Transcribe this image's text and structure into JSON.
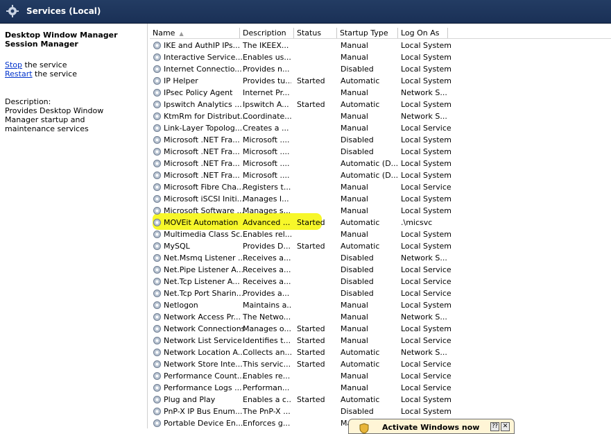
{
  "window": {
    "title": "Services (Local)"
  },
  "details": {
    "service_name": "Desktop Window Manager Session Manager",
    "stop_link": "Stop",
    "stop_suffix": " the service",
    "restart_link": "Restart",
    "restart_suffix": " the service",
    "description_label": "Description:",
    "description_text": "Provides Desktop Window Manager startup and maintenance services"
  },
  "columns": {
    "name": "Name",
    "description": "Description",
    "status": "Status",
    "startup_type": "Startup Type",
    "log_on_as": "Log On As"
  },
  "rows": [
    {
      "name": "IKE and AuthIP IPs...",
      "description": "The IKEEX...",
      "status": "",
      "startup": "Manual",
      "logon": "Local System"
    },
    {
      "name": "Interactive Service...",
      "description": "Enables us...",
      "status": "",
      "startup": "Manual",
      "logon": "Local System"
    },
    {
      "name": "Internet Connectio...",
      "description": "Provides n...",
      "status": "",
      "startup": "Disabled",
      "logon": "Local System"
    },
    {
      "name": "IP Helper",
      "description": "Provides tu...",
      "status": "Started",
      "startup": "Automatic",
      "logon": "Local System"
    },
    {
      "name": "IPsec Policy Agent",
      "description": "Internet Pr...",
      "status": "",
      "startup": "Manual",
      "logon": "Network S..."
    },
    {
      "name": "Ipswitch Analytics ...",
      "description": "Ipswitch A...",
      "status": "Started",
      "startup": "Automatic",
      "logon": "Local System"
    },
    {
      "name": "KtmRm for Distribut...",
      "description": "Coordinate...",
      "status": "",
      "startup": "Manual",
      "logon": "Network S..."
    },
    {
      "name": "Link-Layer Topolog...",
      "description": "Creates a ...",
      "status": "",
      "startup": "Manual",
      "logon": "Local Service"
    },
    {
      "name": "Microsoft .NET Fra...",
      "description": "Microsoft ....",
      "status": "",
      "startup": "Disabled",
      "logon": "Local System"
    },
    {
      "name": "Microsoft .NET Fra...",
      "description": "Microsoft ....",
      "status": "",
      "startup": "Disabled",
      "logon": "Local System"
    },
    {
      "name": "Microsoft .NET Fra...",
      "description": "Microsoft ....",
      "status": "",
      "startup": "Automatic (D...",
      "logon": "Local System"
    },
    {
      "name": "Microsoft .NET Fra...",
      "description": "Microsoft ....",
      "status": "",
      "startup": "Automatic (D...",
      "logon": "Local System"
    },
    {
      "name": "Microsoft Fibre Cha...",
      "description": "Registers t...",
      "status": "",
      "startup": "Manual",
      "logon": "Local Service"
    },
    {
      "name": "Microsoft iSCSI Initi...",
      "description": "Manages I...",
      "status": "",
      "startup": "Manual",
      "logon": "Local System"
    },
    {
      "name": "Microsoft Software ...",
      "description": "Manages s...",
      "status": "",
      "startup": "Manual",
      "logon": "Local System"
    },
    {
      "name": "MOVEit Automation",
      "description": "Advanced ...",
      "status": "Started",
      "startup": "Automatic",
      "logon": ".\\micsvc"
    },
    {
      "name": "Multimedia Class Sc...",
      "description": "Enables rel...",
      "status": "",
      "startup": "Manual",
      "logon": "Local System"
    },
    {
      "name": "MySQL",
      "description": "Provides D...",
      "status": "Started",
      "startup": "Automatic",
      "logon": "Local System"
    },
    {
      "name": "Net.Msmq Listener ...",
      "description": "Receives a...",
      "status": "",
      "startup": "Disabled",
      "logon": "Network S..."
    },
    {
      "name": "Net.Pipe Listener A...",
      "description": "Receives a...",
      "status": "",
      "startup": "Disabled",
      "logon": "Local Service"
    },
    {
      "name": "Net.Tcp Listener A...",
      "description": "Receives a...",
      "status": "",
      "startup": "Disabled",
      "logon": "Local Service"
    },
    {
      "name": "Net.Tcp Port Sharin...",
      "description": "Provides a...",
      "status": "",
      "startup": "Disabled",
      "logon": "Local Service"
    },
    {
      "name": "Netlogon",
      "description": "Maintains a...",
      "status": "",
      "startup": "Manual",
      "logon": "Local System"
    },
    {
      "name": "Network Access Pr...",
      "description": "The Netwo...",
      "status": "",
      "startup": "Manual",
      "logon": "Network S..."
    },
    {
      "name": "Network Connections",
      "description": "Manages o...",
      "status": "Started",
      "startup": "Manual",
      "logon": "Local System"
    },
    {
      "name": "Network List Service",
      "description": "Identifies t...",
      "status": "Started",
      "startup": "Manual",
      "logon": "Local Service"
    },
    {
      "name": "Network Location A...",
      "description": "Collects an...",
      "status": "Started",
      "startup": "Automatic",
      "logon": "Network S..."
    },
    {
      "name": "Network Store Inte...",
      "description": "This servic...",
      "status": "Started",
      "startup": "Automatic",
      "logon": "Local Service"
    },
    {
      "name": "Performance Count...",
      "description": "Enables re...",
      "status": "",
      "startup": "Manual",
      "logon": "Local Service"
    },
    {
      "name": "Performance Logs ...",
      "description": "Performan...",
      "status": "",
      "startup": "Manual",
      "logon": "Local Service"
    },
    {
      "name": "Plug and Play",
      "description": "Enables a c...",
      "status": "Started",
      "startup": "Automatic",
      "logon": "Local System"
    },
    {
      "name": "PnP-X IP Bus Enum...",
      "description": "The PnP-X ...",
      "status": "",
      "startup": "Disabled",
      "logon": "Local System"
    },
    {
      "name": "Portable Device En...",
      "description": "Enforces g...",
      "status": "",
      "startup": "Ma",
      "logon": ""
    }
  ],
  "notification": {
    "text": "Activate Windows now",
    "icon": "shield-icon"
  },
  "colors": {
    "titlebar": "#1a3056",
    "highlight": "#f7f72a",
    "link": "#0033cc"
  }
}
